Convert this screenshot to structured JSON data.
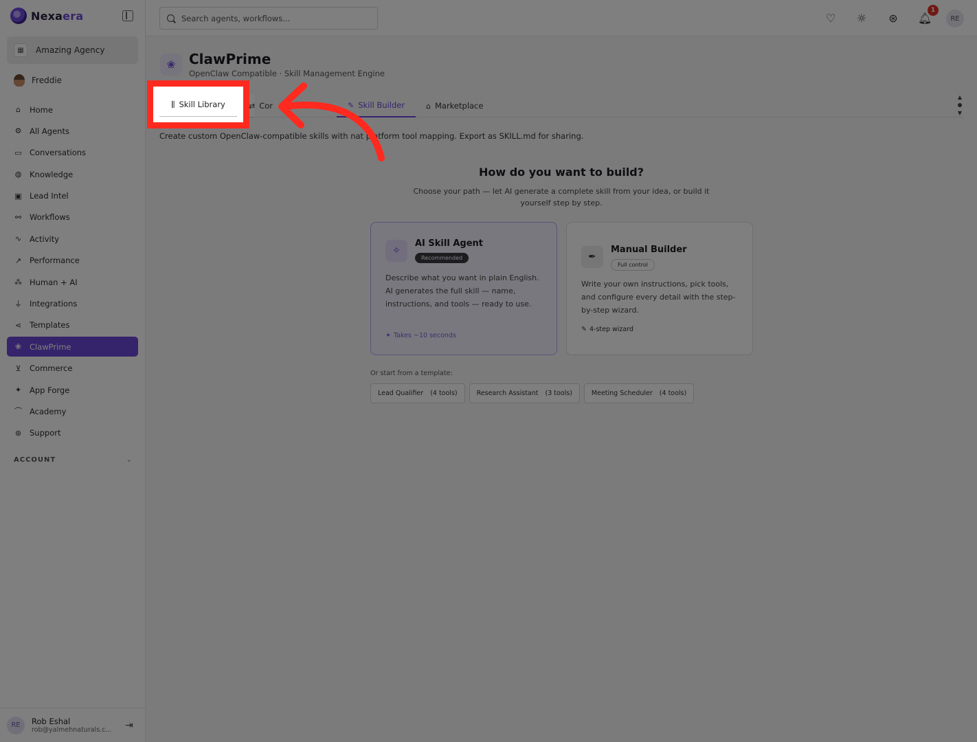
{
  "brand": {
    "name_part1": "Nexa",
    "name_part2": "era"
  },
  "sidebar": {
    "agency": "Amazing Agency",
    "user": "Freddie",
    "items": [
      {
        "label": "Home",
        "icon": "⌂",
        "name": "home"
      },
      {
        "label": "All Agents",
        "icon": "⚙",
        "name": "all-agents"
      },
      {
        "label": "Conversations",
        "icon": "▭",
        "name": "conversations"
      },
      {
        "label": "Knowledge",
        "icon": "◍",
        "name": "knowledge"
      },
      {
        "label": "Lead Intel",
        "icon": "▣",
        "name": "lead-intel"
      },
      {
        "label": "Workflows",
        "icon": "⚯",
        "name": "workflows"
      },
      {
        "label": "Activity",
        "icon": "∿",
        "name": "activity"
      },
      {
        "label": "Performance",
        "icon": "↗",
        "name": "performance"
      },
      {
        "label": "Human + AI",
        "icon": "⁂",
        "name": "human-ai"
      },
      {
        "label": "Integrations",
        "icon": "⏚",
        "name": "integrations"
      },
      {
        "label": "Templates",
        "icon": "⋖",
        "name": "templates"
      },
      {
        "label": "ClawPrime",
        "icon": "❀",
        "name": "clawprime",
        "active": true
      },
      {
        "label": "Commerce",
        "icon": "⊻",
        "name": "commerce"
      },
      {
        "label": "App Forge",
        "icon": "✦",
        "name": "app-forge"
      },
      {
        "label": "Academy",
        "icon": "⌒",
        "name": "academy"
      },
      {
        "label": "Support",
        "icon": "⊛",
        "name": "support"
      }
    ],
    "account_label": "ACCOUNT",
    "footer": {
      "avatar": "RE",
      "name": "Rob Eshal",
      "email": "rob@yalmehnaturals.c..."
    }
  },
  "topbar": {
    "search_placeholder": "Search agents, workflows...",
    "notification_count": "1",
    "avatar": "RE"
  },
  "page": {
    "title": "ClawPrime",
    "subtitle": "OpenClaw Compatible · Skill Management Engine",
    "tabs": {
      "library": "Skill Library",
      "compare": "Cor",
      "builder": "Skill Builder",
      "market": "Marketplace"
    },
    "description": "Create custom OpenClaw-compatible skills with nat     platform tool mapping. Export as SKILL.md for sharing.",
    "build_title": "How do you want to build?",
    "build_sub": "Choose your path — let AI generate a complete skill from your idea, or build it yourself step by step.",
    "ai_card": {
      "title": "AI Skill Agent",
      "badge": "Recommended",
      "desc": "Describe what you want in plain English. AI generates the full skill — name, instructions, and tools — ready to use.",
      "foot": "Takes ~10 seconds"
    },
    "manual_card": {
      "title": "Manual Builder",
      "badge": "Full control",
      "desc": "Write your own instructions, pick tools, and configure every detail with the step-by-step wizard.",
      "foot": "4-step wizard"
    },
    "template_label": "Or start from a template:",
    "templates": [
      {
        "name": "Lead Qualifier",
        "tools": "(4 tools)"
      },
      {
        "name": "Research Assistant",
        "tools": "(3 tools)"
      },
      {
        "name": "Meeting Scheduler",
        "tools": "(4 tools)"
      }
    ]
  },
  "colors": {
    "accent": "#6b47d6",
    "highlight": "#ff2a1f"
  }
}
